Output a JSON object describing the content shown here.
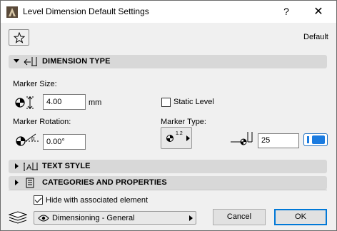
{
  "window": {
    "title": "Level Dimension Default Settings",
    "help_label": "?",
    "close_label": "✕"
  },
  "toolbar": {
    "favorites_icon": "star-icon",
    "default_label": "Default"
  },
  "sections": {
    "dimension_type": {
      "title": "DIMENSION TYPE",
      "expanded": true
    },
    "text_style": {
      "title": "TEXT STYLE",
      "expanded": false
    },
    "categories": {
      "title": "CATEGORIES AND PROPERTIES",
      "expanded": false
    }
  },
  "dimension_type": {
    "marker_size_label": "Marker Size:",
    "marker_size_value": "4.00",
    "marker_size_unit": "mm",
    "static_level_label": "Static Level",
    "static_level_checked": false,
    "marker_rotation_label": "Marker Rotation:",
    "marker_rotation_value": "0.00°",
    "marker_type_label": "Marker Type:",
    "marker_type_glyph": "1.2",
    "pen_value": "25",
    "pen_color": "#1a7be0"
  },
  "footer": {
    "hide_label": "Hide with associated element",
    "hide_checked": true,
    "layer_value": "Dimensioning - General",
    "cancel_label": "Cancel",
    "ok_label": "OK"
  }
}
